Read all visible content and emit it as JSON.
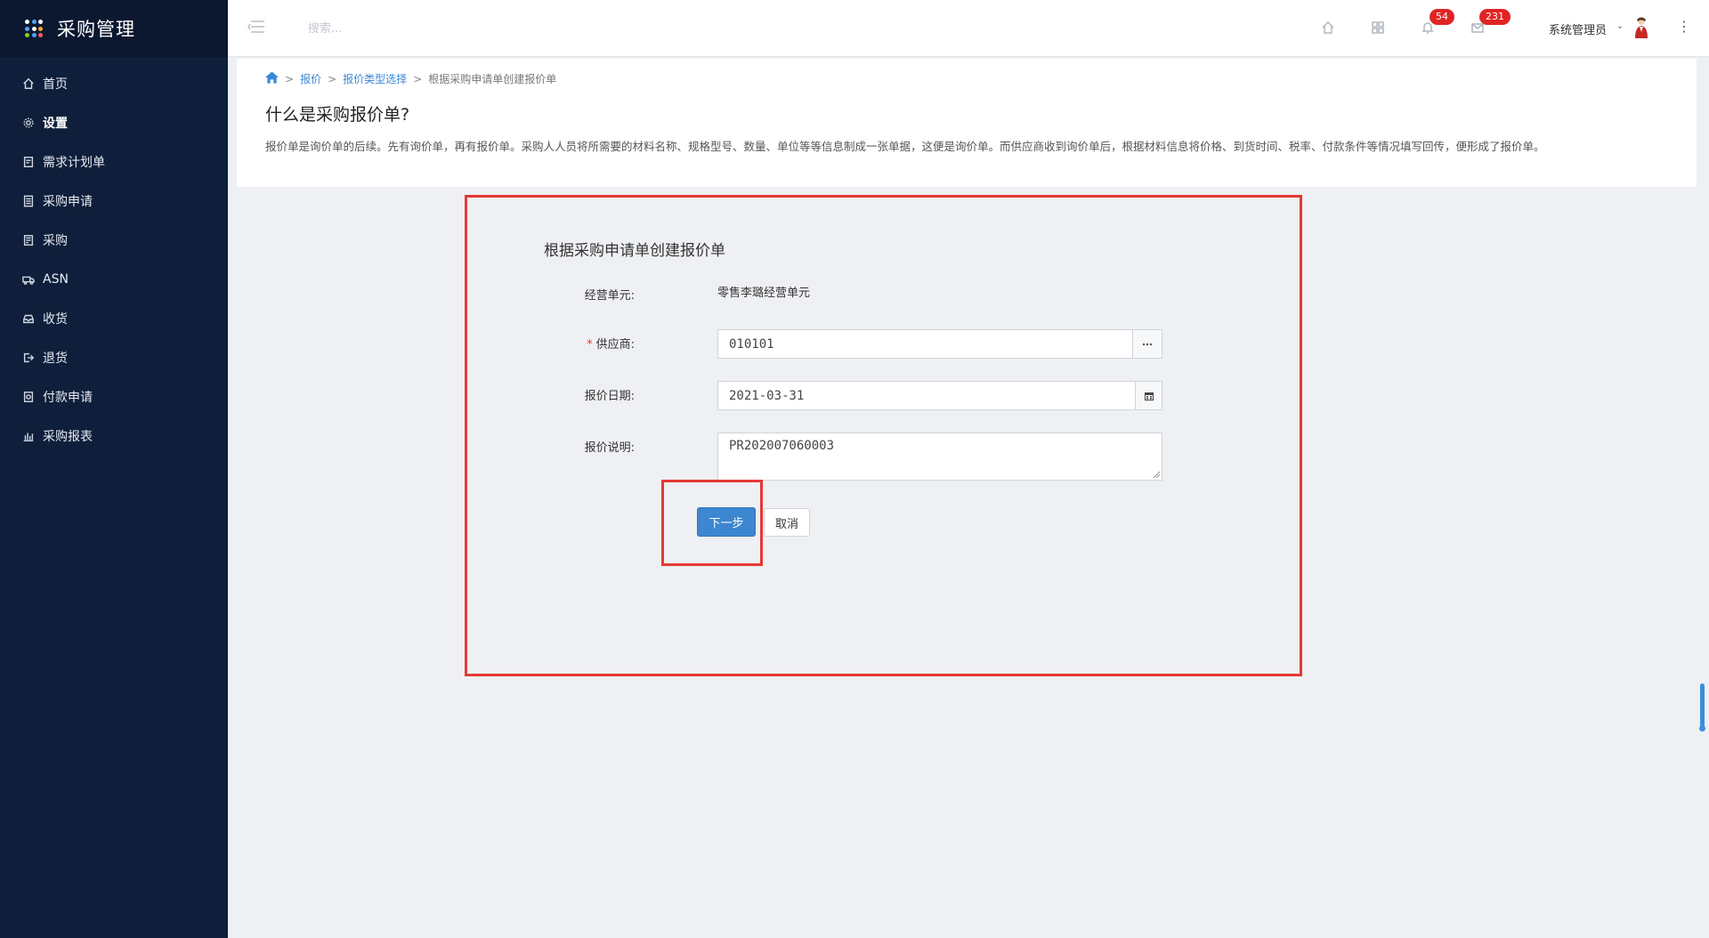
{
  "app": {
    "title": "采购管理",
    "logo_dots": [
      "#ffffff",
      "#4fa3ff",
      "#ffffff",
      "#4fa3ff",
      "#ffffff",
      "#f5a623",
      "#7ed321",
      "#4fa3ff",
      "#ff5a5a"
    ]
  },
  "sidebar": {
    "items": [
      {
        "label": "首页",
        "icon": "home-icon",
        "active": false
      },
      {
        "label": "设置",
        "icon": "gear-icon",
        "active": true
      },
      {
        "label": "需求计划单",
        "icon": "document-icon",
        "active": false
      },
      {
        "label": "采购申请",
        "icon": "calculator-icon",
        "active": false
      },
      {
        "label": "采购",
        "icon": "list-document-icon",
        "active": false
      },
      {
        "label": "ASN",
        "icon": "truck-icon",
        "active": false
      },
      {
        "label": "收货",
        "icon": "inbox-icon",
        "active": false
      },
      {
        "label": "退货",
        "icon": "sign-out-icon",
        "active": false
      },
      {
        "label": "付款申请",
        "icon": "payment-icon",
        "active": false
      },
      {
        "label": "采购报表",
        "icon": "bar-chart-icon",
        "active": false
      }
    ]
  },
  "topbar": {
    "search_placeholder": "搜索...",
    "notifications_count": "54",
    "messages_count": "231",
    "user_name": "系统管理员",
    "user_caret": "⌄"
  },
  "breadcrumb": {
    "items": [
      "报价",
      "报价类型选择"
    ],
    "current": "根据采购申请单创建报价单",
    "separator": ">"
  },
  "page": {
    "title": "什么是采购报价单?",
    "description": "报价单是询价单的后续。先有询价单，再有报价单。采购人人员将所需要的材料名称、规格型号、数量、单位等等信息制成一张单据，这便是询价单。而供应商收到询价单后，根据材料信息将价格、到货时间、税率、付款条件等情况填写回传，便形成了报价单。"
  },
  "form": {
    "title": "根据采购申请单创建报价单",
    "business_unit_label": "经营单元:",
    "business_unit_value": "零售李璐经营单元",
    "required_mark": "*",
    "supplier_label": "供应商:",
    "supplier_value": "010101",
    "quote_date_label": "报价日期:",
    "quote_date_value": "2021-03-31",
    "quote_note_label": "报价说明:",
    "quote_note_value": "PR202007060003",
    "next_button": "下一步",
    "cancel_button": "取消"
  },
  "colors": {
    "sidebar_bg": "#0f1f3b",
    "primary": "#3d86d0",
    "highlight": "#e53935",
    "badge": "#e02424"
  }
}
